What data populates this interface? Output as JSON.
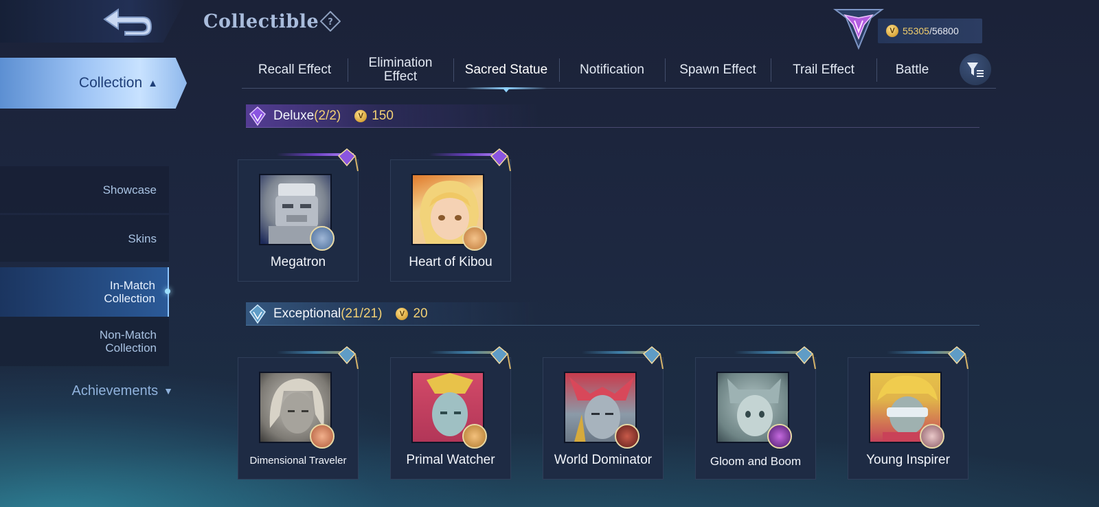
{
  "header": {
    "title": "Collectible",
    "points": {
      "current": "55305",
      "separator": "/",
      "max": "56800"
    }
  },
  "sidebar": {
    "collection_label": "Collection",
    "items": [
      {
        "label": "Showcase"
      },
      {
        "label": "Skins"
      },
      {
        "label": "In-Match\nCollection"
      },
      {
        "label": "Non-Match\nCollection"
      }
    ],
    "achievements_label": "Achievements"
  },
  "tabs": [
    {
      "label": "Recall Effect"
    },
    {
      "label": "Elimination\nEffect"
    },
    {
      "label": "Sacred Statue",
      "active": true
    },
    {
      "label": "Notification"
    },
    {
      "label": "Spawn Effect"
    },
    {
      "label": "Trail Effect"
    },
    {
      "label": "Battle"
    }
  ],
  "sections": {
    "deluxe": {
      "label": "Deluxe",
      "count": "(2/2)",
      "price": "150",
      "items": [
        {
          "name": "Megatron"
        },
        {
          "name": "Heart of Kibou"
        }
      ]
    },
    "exceptional": {
      "label": "Exceptional",
      "count": "(21/21)",
      "price": "20",
      "items": [
        {
          "name": "Dimensional Traveler"
        },
        {
          "name": "Primal Watcher"
        },
        {
          "name": "World Dominator"
        },
        {
          "name": "Gloom and Boom"
        },
        {
          "name": "Young Inspirer"
        }
      ]
    }
  },
  "colors": {
    "gold": "#f2d074",
    "deluxe_purple": "#8a55e0",
    "exceptional_teal": "#6fb3d6",
    "active_blue": "#8fd2ff"
  }
}
